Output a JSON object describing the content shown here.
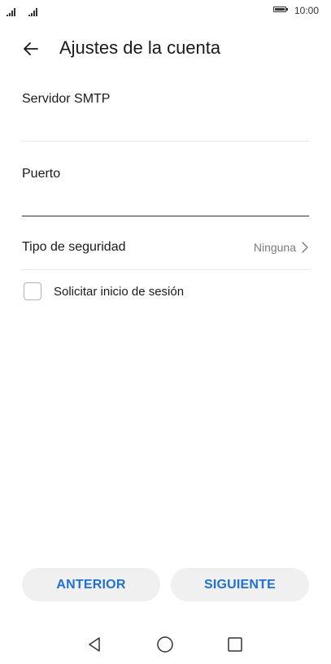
{
  "status_bar": {
    "time": "10:00",
    "battery_level": 1.0,
    "signal_bars": 4
  },
  "header": {
    "back_icon": "arrow-left-icon",
    "title": "Ajustes de la cuenta"
  },
  "fields": {
    "smtp": {
      "label": "Servidor SMTP",
      "value": "",
      "placeholder": ""
    },
    "port": {
      "label": "Puerto",
      "value": "",
      "placeholder": ""
    }
  },
  "security": {
    "label": "Tipo de seguridad",
    "value": "Ninguna",
    "icon": "chevron-right-icon"
  },
  "login_checkbox": {
    "label": "Solicitar inicio de sesión",
    "checked": false
  },
  "buttons": {
    "previous": "ANTERIOR",
    "next": "SIGUIENTE"
  },
  "nav_bar": {
    "icons": [
      "triangle-back-icon",
      "circle-home-icon",
      "square-recents-icon"
    ]
  },
  "colors": {
    "accent": "#2070d6",
    "button_bg": "#f0f0f0",
    "divider": "#e6e6e6",
    "active_underline": "#333333",
    "secondary_text": "#7a7a7a"
  }
}
